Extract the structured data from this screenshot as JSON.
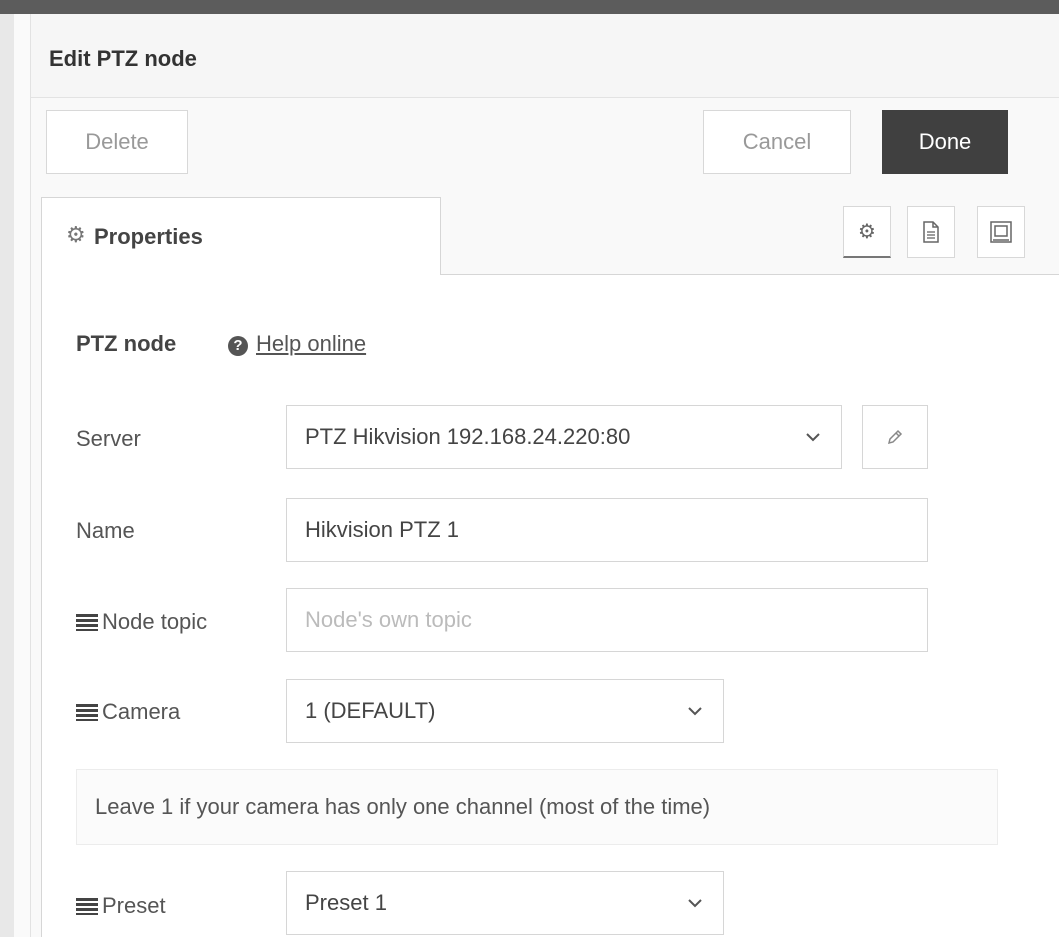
{
  "dialog": {
    "title": "Edit PTZ node"
  },
  "toolbar": {
    "delete_label": "Delete",
    "cancel_label": "Cancel",
    "done_label": "Done"
  },
  "tabs": {
    "properties_label": "Properties"
  },
  "tab_icons": [
    "gear-icon",
    "document-icon",
    "frame-icon"
  ],
  "form": {
    "section_title": "PTZ node",
    "help_link": "Help online",
    "server": {
      "label": "Server",
      "value": "PTZ Hikvision 192.168.24.220:80"
    },
    "name": {
      "label": "Name",
      "value": "Hikvision PTZ 1"
    },
    "topic": {
      "label": "Node topic",
      "placeholder": "Node's own topic"
    },
    "camera": {
      "label": "Camera",
      "value": "1 (DEFAULT)"
    },
    "camera_tip": "Leave 1 if your camera has only one channel (most of the time)",
    "preset": {
      "label": "Preset",
      "value": "Preset 1"
    }
  },
  "colors": {
    "done_bg": "#404040",
    "border": "#d6d6d6",
    "text": "#555555"
  }
}
